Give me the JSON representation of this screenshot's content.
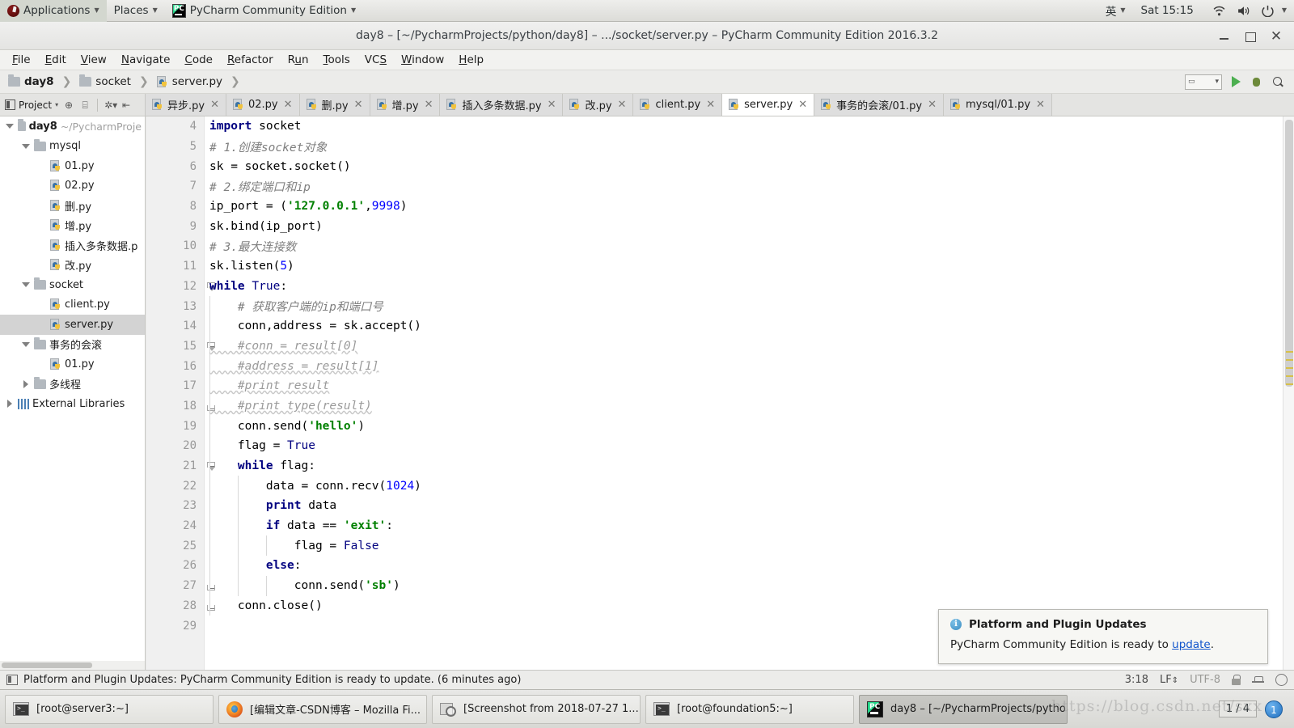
{
  "gnome": {
    "applications": "Applications",
    "places": "Places",
    "app_name": "PyCharm Community Edition",
    "input_method": "英",
    "clock": "Sat 15:15"
  },
  "window": {
    "title": "day8 – [~/PycharmProjects/python/day8] – .../socket/server.py – PyCharm Community Edition 2016.3.2"
  },
  "menubar": [
    {
      "label": "File"
    },
    {
      "label": "Edit"
    },
    {
      "label": "View"
    },
    {
      "label": "Navigate"
    },
    {
      "label": "Code"
    },
    {
      "label": "Refactor"
    },
    {
      "label": "Run"
    },
    {
      "label": "Tools"
    },
    {
      "label": "VCS"
    },
    {
      "label": "Window"
    },
    {
      "label": "Help"
    }
  ],
  "breadcrumb": [
    {
      "label": "day8",
      "icon": "folder-icon",
      "bold": true
    },
    {
      "label": "socket",
      "icon": "folder-icon",
      "bold": false
    },
    {
      "label": "server.py",
      "icon": "python-file-icon",
      "bold": false
    }
  ],
  "toolwindow": {
    "project_label": "Project"
  },
  "editor_tabs": [
    {
      "label": "异步.py",
      "active": false
    },
    {
      "label": "02.py",
      "active": false
    },
    {
      "label": "删.py",
      "active": false
    },
    {
      "label": "增.py",
      "active": false
    },
    {
      "label": "插入多条数据.py",
      "active": false
    },
    {
      "label": "改.py",
      "active": false
    },
    {
      "label": "client.py",
      "active": false
    },
    {
      "label": "server.py",
      "active": true
    },
    {
      "label": "事务的会滚/01.py",
      "active": false
    },
    {
      "label": "mysql/01.py",
      "active": false
    }
  ],
  "project_tree": [
    {
      "label": "day8",
      "path": "~/PycharmProje",
      "depth": 0,
      "arrow": "down",
      "icon": "folder-icon",
      "bold": true,
      "selected": false
    },
    {
      "label": "mysql",
      "path": "",
      "depth": 1,
      "arrow": "down",
      "icon": "folder-icon",
      "bold": false,
      "selected": false
    },
    {
      "label": "01.py",
      "path": "",
      "depth": 2,
      "arrow": "none",
      "icon": "python-file-icon",
      "bold": false,
      "selected": false
    },
    {
      "label": "02.py",
      "path": "",
      "depth": 2,
      "arrow": "none",
      "icon": "python-file-icon",
      "bold": false,
      "selected": false
    },
    {
      "label": "删.py",
      "path": "",
      "depth": 2,
      "arrow": "none",
      "icon": "python-file-icon",
      "bold": false,
      "selected": false
    },
    {
      "label": "增.py",
      "path": "",
      "depth": 2,
      "arrow": "none",
      "icon": "python-file-icon",
      "bold": false,
      "selected": false
    },
    {
      "label": "插入多条数据.p",
      "path": "",
      "depth": 2,
      "arrow": "none",
      "icon": "python-file-icon",
      "bold": false,
      "selected": false
    },
    {
      "label": "改.py",
      "path": "",
      "depth": 2,
      "arrow": "none",
      "icon": "python-file-icon",
      "bold": false,
      "selected": false
    },
    {
      "label": "socket",
      "path": "",
      "depth": 1,
      "arrow": "down",
      "icon": "folder-icon",
      "bold": false,
      "selected": false
    },
    {
      "label": "client.py",
      "path": "",
      "depth": 2,
      "arrow": "none",
      "icon": "python-file-icon",
      "bold": false,
      "selected": false
    },
    {
      "label": "server.py",
      "path": "",
      "depth": 2,
      "arrow": "none",
      "icon": "python-file-icon",
      "bold": false,
      "selected": true
    },
    {
      "label": "事务的会滚",
      "path": "",
      "depth": 1,
      "arrow": "down",
      "icon": "folder-icon",
      "bold": false,
      "selected": false
    },
    {
      "label": "01.py",
      "path": "",
      "depth": 2,
      "arrow": "none",
      "icon": "python-file-icon",
      "bold": false,
      "selected": false
    },
    {
      "label": "多线程",
      "path": "",
      "depth": 1,
      "arrow": "right",
      "icon": "folder-icon",
      "bold": false,
      "selected": false
    },
    {
      "label": "External Libraries",
      "path": "",
      "depth": 0,
      "arrow": "right",
      "icon": "library-icon",
      "bold": false,
      "selected": false
    }
  ],
  "code": {
    "first_line_number": 4,
    "lines": [
      {
        "n": 4,
        "fold": "none",
        "indent": 0,
        "tokens": [
          {
            "t": "import",
            "c": "kw"
          },
          {
            "t": " socket",
            "c": ""
          }
        ]
      },
      {
        "n": 5,
        "fold": "none",
        "indent": 0,
        "tokens": [
          {
            "t": "# 1.创建socket对象",
            "c": "cm"
          }
        ]
      },
      {
        "n": 6,
        "fold": "none",
        "indent": 0,
        "tokens": [
          {
            "t": "sk = socket.socket()",
            "c": ""
          }
        ]
      },
      {
        "n": 7,
        "fold": "none",
        "indent": 0,
        "tokens": [
          {
            "t": "# 2.绑定端口和ip",
            "c": "cm"
          }
        ]
      },
      {
        "n": 8,
        "fold": "none",
        "indent": 0,
        "tokens": [
          {
            "t": "ip_port = (",
            "c": ""
          },
          {
            "t": "'127.0.0.1'",
            "c": "str"
          },
          {
            "t": ",",
            "c": ""
          },
          {
            "t": "9998",
            "c": "num"
          },
          {
            "t": ")",
            "c": ""
          }
        ]
      },
      {
        "n": 9,
        "fold": "none",
        "indent": 0,
        "tokens": [
          {
            "t": "sk.bind(ip_port)",
            "c": ""
          }
        ]
      },
      {
        "n": 10,
        "fold": "none",
        "indent": 0,
        "tokens": [
          {
            "t": "# 3.最大连接数",
            "c": "cm"
          }
        ]
      },
      {
        "n": 11,
        "fold": "none",
        "indent": 0,
        "tokens": [
          {
            "t": "sk.listen(",
            "c": ""
          },
          {
            "t": "5",
            "c": "num"
          },
          {
            "t": ")",
            "c": ""
          }
        ]
      },
      {
        "n": 12,
        "fold": "tri",
        "indent": 0,
        "tokens": [
          {
            "t": "while",
            "c": "kw"
          },
          {
            "t": " ",
            "c": ""
          },
          {
            "t": "True",
            "c": "kw2"
          },
          {
            "t": ":",
            "c": ""
          }
        ]
      },
      {
        "n": 13,
        "fold": "none",
        "indent": 1,
        "tokens": [
          {
            "t": "    # 获取客户端的ip和端口号",
            "c": "cm"
          }
        ]
      },
      {
        "n": 14,
        "fold": "none",
        "indent": 1,
        "tokens": [
          {
            "t": "    conn,address = sk.accept()",
            "c": ""
          }
        ]
      },
      {
        "n": 15,
        "fold": "tri",
        "indent": 1,
        "tokens": [
          {
            "t": "    #conn = result[0]",
            "c": "cm-code"
          }
        ]
      },
      {
        "n": 16,
        "fold": "none",
        "indent": 1,
        "tokens": [
          {
            "t": "    #address = result[1]",
            "c": "cm-code"
          }
        ]
      },
      {
        "n": 17,
        "fold": "none",
        "indent": 1,
        "tokens": [
          {
            "t": "    #print result",
            "c": "cm-code"
          }
        ]
      },
      {
        "n": 18,
        "fold": "end",
        "indent": 1,
        "tokens": [
          {
            "t": "    #print type(result)",
            "c": "cm-code"
          }
        ]
      },
      {
        "n": 19,
        "fold": "none",
        "indent": 1,
        "tokens": [
          {
            "t": "    conn.send(",
            "c": ""
          },
          {
            "t": "'hello'",
            "c": "str"
          },
          {
            "t": ")",
            "c": ""
          }
        ]
      },
      {
        "n": 20,
        "fold": "none",
        "indent": 1,
        "tokens": [
          {
            "t": "    flag = ",
            "c": ""
          },
          {
            "t": "True",
            "c": "kw2"
          }
        ]
      },
      {
        "n": 21,
        "fold": "tri",
        "indent": 1,
        "tokens": [
          {
            "t": "    ",
            "c": ""
          },
          {
            "t": "while",
            "c": "kw"
          },
          {
            "t": " flag:",
            "c": ""
          }
        ]
      },
      {
        "n": 22,
        "fold": "none",
        "indent": 2,
        "tokens": [
          {
            "t": "        data = conn.recv(",
            "c": ""
          },
          {
            "t": "1024",
            "c": "num"
          },
          {
            "t": ")",
            "c": ""
          }
        ]
      },
      {
        "n": 23,
        "fold": "none",
        "indent": 2,
        "tokens": [
          {
            "t": "        ",
            "c": ""
          },
          {
            "t": "print",
            "c": "kw"
          },
          {
            "t": " data",
            "c": ""
          }
        ]
      },
      {
        "n": 24,
        "fold": "none",
        "indent": 2,
        "tokens": [
          {
            "t": "        ",
            "c": ""
          },
          {
            "t": "if",
            "c": "kw"
          },
          {
            "t": " data == ",
            "c": ""
          },
          {
            "t": "'exit'",
            "c": "str"
          },
          {
            "t": ":",
            "c": ""
          }
        ]
      },
      {
        "n": 25,
        "fold": "none",
        "indent": 3,
        "tokens": [
          {
            "t": "            flag = ",
            "c": ""
          },
          {
            "t": "False",
            "c": "kw2"
          }
        ]
      },
      {
        "n": 26,
        "fold": "none",
        "indent": 2,
        "tokens": [
          {
            "t": "        ",
            "c": ""
          },
          {
            "t": "else",
            "c": "kw"
          },
          {
            "t": ":",
            "c": ""
          }
        ]
      },
      {
        "n": 27,
        "fold": "end",
        "indent": 3,
        "tokens": [
          {
            "t": "            conn.send(",
            "c": ""
          },
          {
            "t": "'sb'",
            "c": "str"
          },
          {
            "t": ")",
            "c": ""
          }
        ]
      },
      {
        "n": 28,
        "fold": "end",
        "indent": 1,
        "tokens": [
          {
            "t": "    conn.close()",
            "c": ""
          }
        ]
      },
      {
        "n": 29,
        "fold": "none",
        "indent": 0,
        "tokens": [
          {
            "t": "",
            "c": ""
          }
        ]
      }
    ]
  },
  "balloon": {
    "title": "Platform and Plugin Updates",
    "body_before": "PyCharm Community Edition is ready to ",
    "link": "update",
    "body_after": "."
  },
  "statusbar": {
    "message": "Platform and Plugin Updates: PyCharm Community Edition is ready to update. (6 minutes ago)",
    "caret": "3:18",
    "line_sep": "LF",
    "encoding": "UTF-8"
  },
  "taskbar": {
    "buttons": [
      {
        "label": "[root@server3:~]",
        "icon": "terminal-icon",
        "active": false
      },
      {
        "label": "[编辑文章-CSDN博客 – Mozilla Fi...",
        "icon": "firefox-icon",
        "active": false
      },
      {
        "label": "[Screenshot from 2018-07-27 1...",
        "icon": "screenshot-icon",
        "active": false
      },
      {
        "label": "[root@foundation5:~]",
        "icon": "terminal-icon",
        "active": false
      },
      {
        "label": "day8 – [~/PycharmProjects/pytho...",
        "icon": "pycharm-icon",
        "active": true
      }
    ],
    "pager": "1 / 4",
    "workspace_badge": "1"
  },
  "watermark": "https://blog.csdn.net/sxx"
}
